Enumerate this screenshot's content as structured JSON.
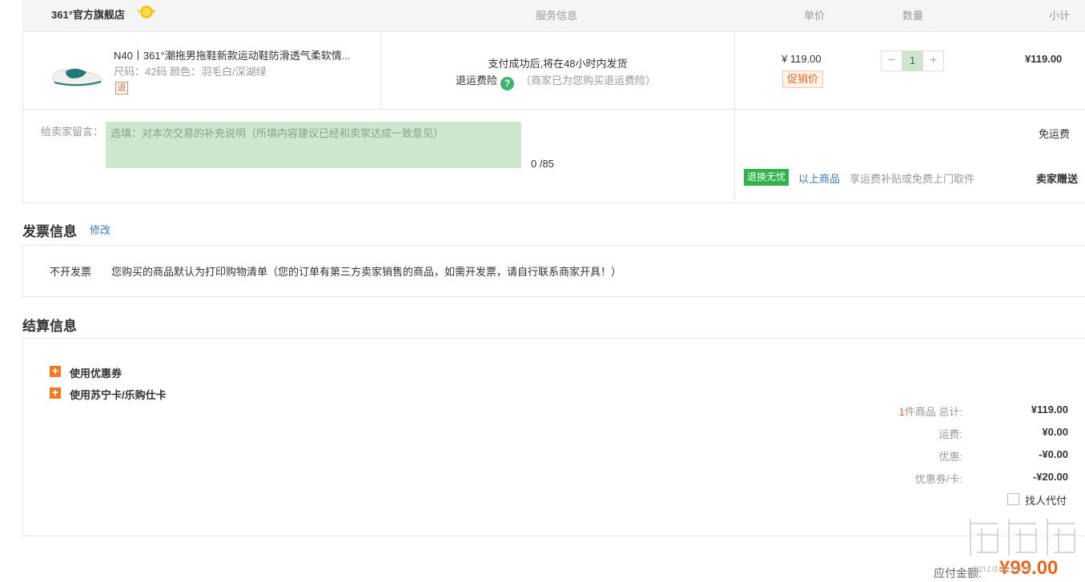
{
  "order_header": {
    "store_name": "361°官方旗舰店",
    "col_service": "服务信息",
    "col_unit_price": "单价",
    "col_quantity": "数量",
    "col_subtotal": "小计"
  },
  "product": {
    "title": "N40丨361°潮拖男拖鞋新款运动鞋防滑透气柔软情...",
    "spec": "尺码：42码    颜色：羽毛白/深湖绿",
    "return_badge": "退",
    "service_line1": "支付成功后,将在48小时内发货",
    "service_insurance": "退运费险",
    "service_help_icon": "?",
    "service_note": "（商家已为您购买退运费险）",
    "unit_price": "¥ 119.00",
    "promo_tag": "促销价",
    "qty_minus": "−",
    "qty_value": "1",
    "qty_plus": "+",
    "subtotal": "¥119.00"
  },
  "message": {
    "label": "给卖家留言：",
    "placeholder": "选填：对本次交易的补充说明（所填内容建议已经和卖家达成一致意见）",
    "count": "0 /85"
  },
  "shipping": {
    "free_shipping": "免运费",
    "return_badge": "退换无忧",
    "return_link": "以上商品",
    "return_desc": "享运费补贴或免费上门取件",
    "seller_gift": "卖家赠送"
  },
  "invoice": {
    "title": "发票信息",
    "edit": "修改",
    "type": "不开发票",
    "desc": "您购买的商品默认为打印购物清单（您的订单有第三方卖家销售的商品，如需开发票，请自行联系商家开具！）"
  },
  "settlement": {
    "title": "结算信息",
    "options": [
      {
        "icon": "+",
        "label": "使用优惠券"
      },
      {
        "icon": "+",
        "label": "使用苏宁卡/乐购仕卡"
      }
    ],
    "total_count": "1",
    "total_label": "件商品 总计:",
    "total_value": "¥119.00",
    "freight_label": "运费:",
    "freight_value": "¥0.00",
    "discount_label": "优惠:",
    "discount_value": "-¥0.00",
    "coupon_label": "优惠券/卡:",
    "coupon_value": "-¥20.00",
    "proxy_pay": "找人代付",
    "pay_label": "应付金额:",
    "pay_value": "¥99.00"
  },
  "watermark": {
    "text": "什么值得买",
    "url": "smzdm.com"
  },
  "colors": {
    "accent_orange": "#e8661c",
    "link_blue": "#3a79c4",
    "badge_green": "#2fb34a",
    "input_green": "#cde7cf"
  }
}
